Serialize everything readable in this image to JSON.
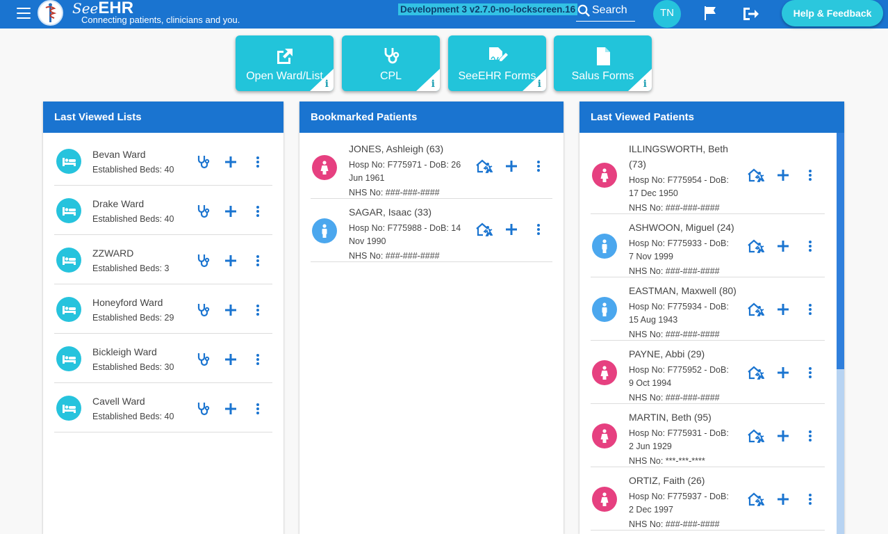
{
  "header": {
    "brand_see": "See",
    "brand_ehr": "EHR",
    "tagline": "Connecting patients, clinicians and you.",
    "environment": "Development 3 v2.7.0-no-lockscreen.16",
    "search_label": "Search",
    "user_initials": "TN",
    "help_label": "Help & Feedback"
  },
  "tiles": [
    {
      "label": "Open Ward/List",
      "icon": "open-external-icon"
    },
    {
      "label": "CPL",
      "icon": "stethoscope-icon"
    },
    {
      "label": "SeeEHR Forms",
      "icon": "form-sign-icon"
    },
    {
      "label": "Salus Forms",
      "icon": "document-icon"
    }
  ],
  "tile_info_glyph": "i",
  "last_viewed_lists": {
    "title": "Last Viewed Lists",
    "items": [
      {
        "name": "Bevan Ward",
        "beds": "Established Beds: 40"
      },
      {
        "name": "Drake Ward",
        "beds": "Established Beds: 40"
      },
      {
        "name": "ZZWARD",
        "beds": "Established Beds: 3"
      },
      {
        "name": "Honeyford Ward",
        "beds": "Established Beds: 29"
      },
      {
        "name": "Bickleigh Ward",
        "beds": "Established Beds: 30"
      },
      {
        "name": "Cavell Ward",
        "beds": "Established Beds: 40"
      }
    ]
  },
  "bookmarked_patients": {
    "title": "Bookmarked Patients",
    "items": [
      {
        "name": "JONES, Ashleigh (63)",
        "hosp": "Hosp No: F775971 - DoB: 26 Jun 1961",
        "nhs": "NHS No: ###-###-####",
        "sex": "f"
      },
      {
        "name": "SAGAR, Isaac (33)",
        "hosp": "Hosp No: F775988 - DoB: 14 Nov 1990",
        "nhs": "NHS No: ###-###-####",
        "sex": "m"
      }
    ]
  },
  "last_viewed_patients": {
    "title": "Last Viewed Patients",
    "items": [
      {
        "name": "ILLINGSWORTH, Beth (73)",
        "hosp": "Hosp No: F775954 - DoB: 17 Dec 1950",
        "nhs": "NHS No: ###-###-####",
        "sex": "f"
      },
      {
        "name": "ASHWOON, Miguel (24)",
        "hosp": "Hosp No: F775933 - DoB: 7 Nov 1999",
        "nhs": "NHS No: ###-###-####",
        "sex": "m"
      },
      {
        "name": "EASTMAN, Maxwell (80)",
        "hosp": "Hosp No: F775934 - DoB: 15 Aug 1943",
        "nhs": "NHS No: ###-###-####",
        "sex": "m"
      },
      {
        "name": "PAYNE, Abbi (29)",
        "hosp": "Hosp No: F775952 - DoB: 9 Oct 1994",
        "nhs": "NHS No: ###-###-####",
        "sex": "f"
      },
      {
        "name": "MARTIN, Beth (95)",
        "hosp": "Hosp No: F775931 - DoB: 2 Jun 1929",
        "nhs": "NHS No: ***-***-****",
        "sex": "f"
      },
      {
        "name": "ORTIZ, Faith (26)",
        "hosp": "Hosp No: F775937 - DoB: 2 Dec 1997",
        "nhs": "NHS No: ###-###-####",
        "sex": "f"
      }
    ]
  },
  "colors": {
    "primary": "#1a74d0",
    "accent": "#22c4da",
    "female": "#e64080",
    "male": "#4ba7ee"
  }
}
